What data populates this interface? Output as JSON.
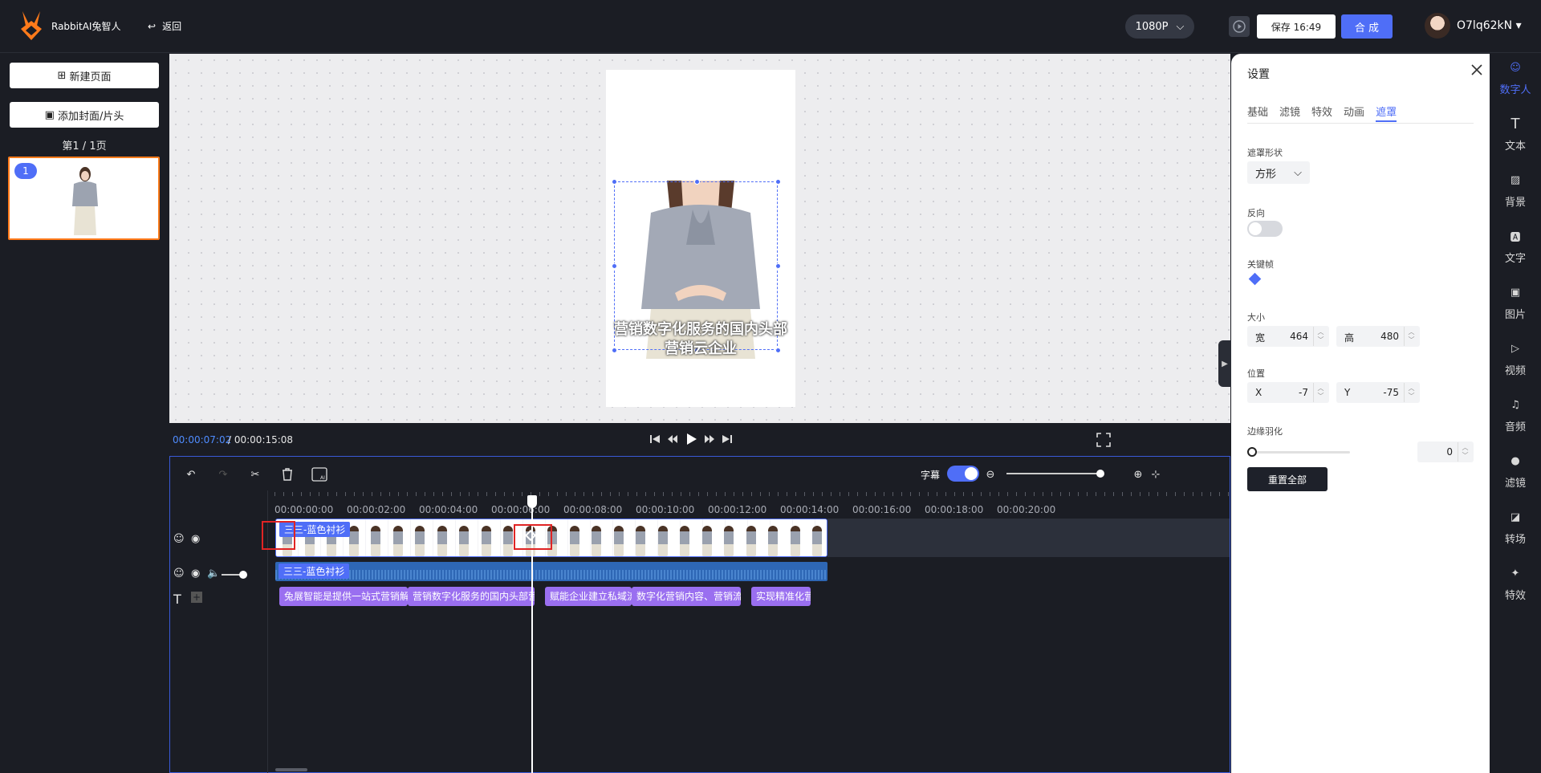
{
  "header": {
    "brand": "RabbitAI兔智人",
    "back_label": "返回",
    "resolution": "1080P",
    "save_label": "保存 16:49",
    "compose_label": "合 成",
    "username": "O7lq62kN"
  },
  "left_panel": {
    "new_page": "新建页面",
    "add_cover": "添加封面/片头",
    "page_count": "第1 / 1页",
    "thumb_index": "1"
  },
  "canvas": {
    "subtitle": "营销数字化服务的国内头部营销云企业"
  },
  "playback": {
    "current_time": "00:00:07:02",
    "total_time": "/ 00:00:15:08"
  },
  "timeline": {
    "subtitle_toggle_label": "字幕",
    "ruler": [
      "00:00:00:00",
      "00:00:02:00",
      "00:00:04:00",
      "00:00:06:00",
      "00:00:08:00",
      "00:00:10:00",
      "00:00:12:00",
      "00:00:14:00",
      "00:00:16:00",
      "00:00:18:00",
      "00:00:20:00"
    ],
    "video_clip_label": "三三-蓝色衬衫",
    "audio_clip_label": "三三-蓝色衬衫",
    "subtitle_clips": [
      "兔展智能是提供一站式营销解决方案",
      "营销数字化服务的国内头部营销云企业",
      "赋能企业建立私域流量池",
      "数字化营销内容、营销流程...",
      "实现精准化营销"
    ]
  },
  "settings": {
    "title": "设置",
    "tabs": [
      "基础",
      "滤镜",
      "特效",
      "动画",
      "遮罩"
    ],
    "active_tab": "遮罩",
    "mask_shape_label": "遮罩形状",
    "mask_shape_value": "方形",
    "reverse_label": "反向",
    "reverse_on": false,
    "keyframe_label": "关键帧",
    "size_label": "大小",
    "width_label": "宽",
    "width_value": "464",
    "height_label": "高",
    "height_value": "480",
    "position_label": "位置",
    "x_label": "X",
    "x_value": "-7",
    "y_label": "Y",
    "y_value": "-75",
    "feather_label": "边缘羽化",
    "feather_value": "0",
    "reset_label": "重置全部"
  },
  "right_nav": [
    {
      "label": "数字人",
      "icon": "digital-human-icon",
      "active": true
    },
    {
      "label": "文本",
      "icon": "text-icon",
      "active": false
    },
    {
      "label": "背景",
      "icon": "background-icon",
      "active": false
    },
    {
      "label": "文字",
      "icon": "font-icon",
      "active": false
    },
    {
      "label": "图片",
      "icon": "image-icon",
      "active": false
    },
    {
      "label": "视频",
      "icon": "video-icon",
      "active": false
    },
    {
      "label": "音频",
      "icon": "audio-icon",
      "active": false
    },
    {
      "label": "滤镜",
      "icon": "filter-icon",
      "active": false
    },
    {
      "label": "转场",
      "icon": "transition-icon",
      "active": false
    },
    {
      "label": "特效",
      "icon": "effects-icon",
      "active": false
    }
  ],
  "colors": {
    "accent": "#4f6ef7",
    "thumb_border": "#ff7a1a",
    "subtitle_clip": "#9a6ff0",
    "highlight_box": "#e02424"
  }
}
